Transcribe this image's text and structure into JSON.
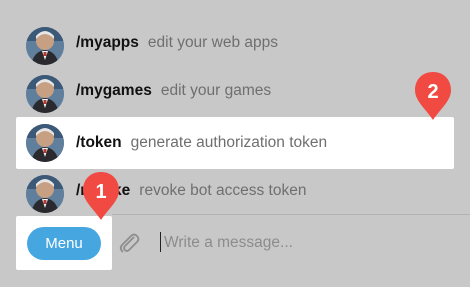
{
  "commands": [
    {
      "name": "/myapps",
      "desc": "edit your web apps"
    },
    {
      "name": "/mygames",
      "desc": "edit your games"
    },
    {
      "name": "/token",
      "desc": "generate authorization token"
    },
    {
      "name": "/revoke",
      "desc": "revoke bot access token"
    }
  ],
  "composer": {
    "menu_label": "Menu",
    "placeholder": "Write a message..."
  },
  "markers": {
    "one": "1",
    "two": "2"
  },
  "colors": {
    "background": "#c8c8c8",
    "highlight": "#ffffff",
    "menu_button": "#46a6e0",
    "marker": "#f04a43"
  },
  "icons": {
    "avatar": "bot-avatar-icon",
    "attach": "paperclip-icon"
  }
}
